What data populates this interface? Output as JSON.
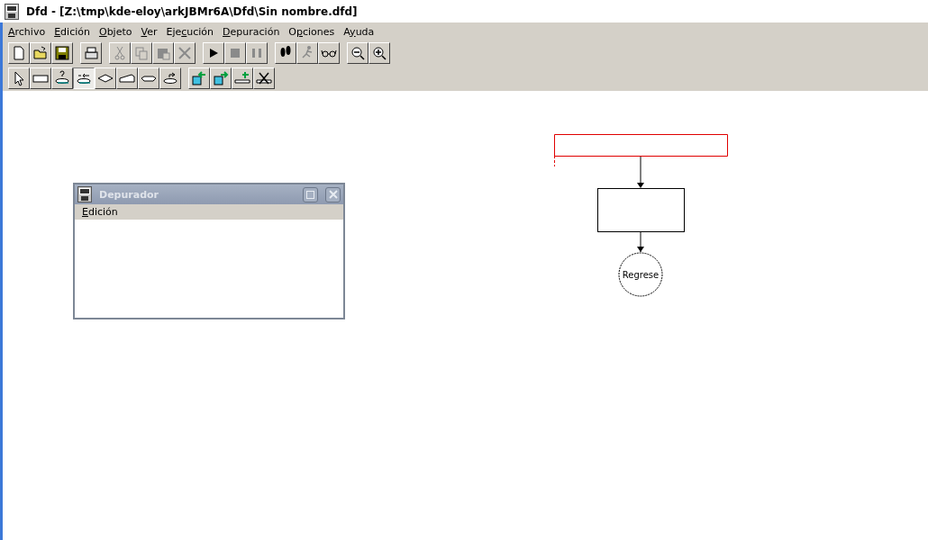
{
  "window": {
    "title": "Dfd - [Z:\\tmp\\kde-eloy\\arkJBMr6A\\Dfd\\Sin nombre.dfd]"
  },
  "menu": [
    {
      "accel": "A",
      "after": "rchivo"
    },
    {
      "accel": "E",
      "after": "dición"
    },
    {
      "accel": "O",
      "after": "bjeto"
    },
    {
      "accel": "V",
      "after": "er"
    },
    {
      "before": "Eje",
      "accel": "c",
      "after": "ución"
    },
    {
      "accel": "D",
      "after": "epuración"
    },
    {
      "before": "O",
      "accel": "p",
      "after": "ciones"
    },
    {
      "before": "A",
      "accel": "y",
      "after": "uda"
    }
  ],
  "toolbar": [
    [
      {
        "kind": "new",
        "disabled": false
      },
      {
        "kind": "open",
        "disabled": false
      },
      {
        "kind": "save",
        "disabled": false
      }
    ],
    [
      {
        "kind": "print",
        "disabled": false
      }
    ],
    [
      {
        "kind": "cut",
        "disabled": true
      },
      {
        "kind": "copy",
        "disabled": true
      },
      {
        "kind": "paste",
        "disabled": true
      },
      {
        "kind": "delete",
        "disabled": true
      }
    ],
    [
      {
        "kind": "run",
        "disabled": false
      },
      {
        "kind": "stop",
        "disabled": true
      },
      {
        "kind": "pause",
        "disabled": true
      }
    ],
    [
      {
        "kind": "step",
        "disabled": false
      },
      {
        "kind": "runner",
        "disabled": true
      },
      {
        "kind": "watch",
        "disabled": false
      }
    ],
    [
      {
        "kind": "zoomout",
        "disabled": false
      },
      {
        "kind": "zoomin",
        "disabled": false
      }
    ]
  ],
  "tools": [
    [
      {
        "kind": "pointer",
        "selected": false
      },
      {
        "kind": "assign",
        "selected": false
      },
      {
        "kind": "read",
        "selected": false
      },
      {
        "kind": "loop",
        "selected": true
      },
      {
        "kind": "decision",
        "selected": false
      },
      {
        "kind": "write",
        "selected": false
      },
      {
        "kind": "call",
        "selected": false
      },
      {
        "kind": "return",
        "selected": false
      }
    ],
    [
      {
        "kind": "subleft",
        "selected": false
      },
      {
        "kind": "subright",
        "selected": false
      },
      {
        "kind": "addparam",
        "selected": false
      },
      {
        "kind": "delparam",
        "selected": false
      }
    ]
  ],
  "debugger": {
    "title": "Depurador",
    "menu": [
      {
        "accel": "E",
        "after": "dición"
      }
    ]
  },
  "diagram": {
    "nodes": [
      {
        "kind": "start",
        "selected": true
      },
      {
        "kind": "process",
        "selected": false
      },
      {
        "kind": "end",
        "selected": false,
        "label": "Regrese"
      }
    ]
  }
}
